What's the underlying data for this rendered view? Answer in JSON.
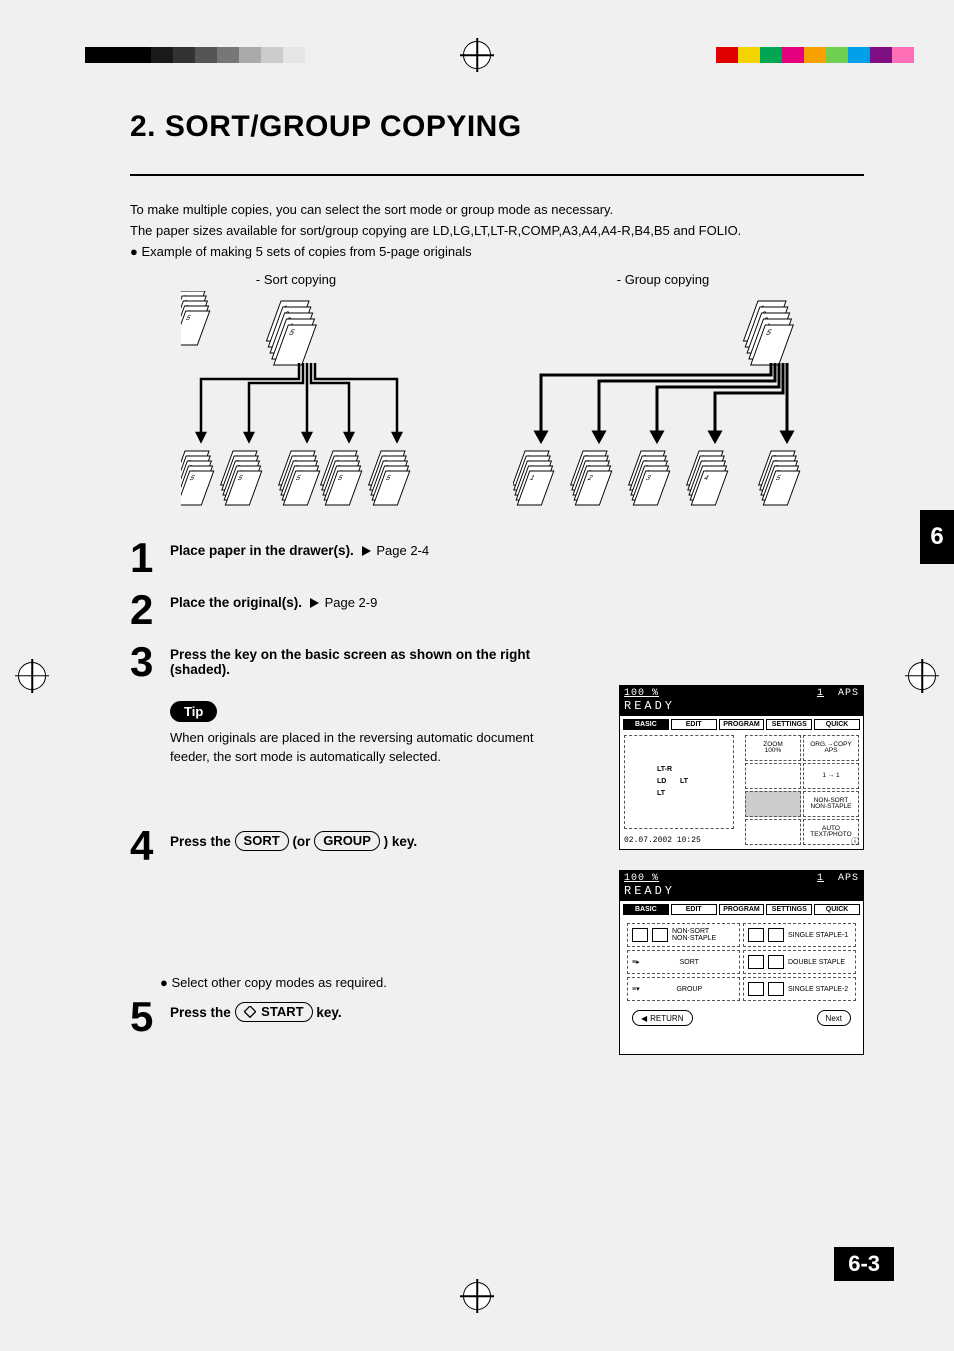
{
  "page": {
    "title": "2. SORT/GROUP COPYING",
    "chapter_tab": "6",
    "page_number": "6-3",
    "intro": {
      "line1": "To make multiple copies, you can select the sort mode or group mode as necessary.",
      "line2": "The paper sizes available for sort/group copying are LD,LG,LT,LT-R,COMP,A3,A4,A4-R,B4,B5 and FOLIO.",
      "bullet": "Example of making 5 sets of copies from 5-page originals"
    },
    "diagrams": {
      "sort_label": "- Sort copying",
      "group_label": "- Group copying"
    },
    "steps": [
      {
        "num": "1",
        "text_bold": "Place paper in the drawer(s).",
        "ref": "Page 2-4"
      },
      {
        "num": "2",
        "text_bold": "Place the original(s).",
        "ref": "Page 2-9"
      },
      {
        "num": "3",
        "text_bold": "Press the key on the basic screen as shown on the right (shaded).",
        "ref": ""
      },
      {
        "num": "4",
        "text_bold_prefix": "Press the ",
        "key1": "SORT",
        "mid": "(or ",
        "key2": "GROUP",
        "text_bold_suffix": ") key.",
        "ref": ""
      },
      {
        "num": "5",
        "text_bold_prefix": "Press the ",
        "startkey": "START",
        "text_bold_suffix": " key.",
        "ref": ""
      }
    ],
    "tip": {
      "label": "Tip",
      "text": "When originals are placed in the reversing automatic document feeder, the sort mode is automatically selected."
    },
    "note_between": "Select other copy modes as required.",
    "screenshot1": {
      "pct": "100 %",
      "qty": "1",
      "aps": "APS",
      "ready": "READY",
      "tabs": [
        "BASIC",
        "EDIT",
        "PROGRAM",
        "SETTINGS",
        "QUICK"
      ],
      "papers": [
        "LT-R",
        "LD",
        "LT",
        "LT"
      ],
      "right_cells": [
        "ZOOM\n100%",
        "ORG.→COPY\nAPS",
        "",
        "1 → 1",
        "",
        "NON-SORT\nNON-STAPLE",
        "",
        "AUTO\nTEXT/PHOTO"
      ],
      "datetime": "02.07.2002 10:25"
    },
    "screenshot2": {
      "pct": "100 %",
      "qty": "1",
      "aps": "APS",
      "ready": "READY",
      "tabs": [
        "BASIC",
        "EDIT",
        "PROGRAM",
        "SETTINGS",
        "QUICK"
      ],
      "left_opts": [
        "NON-SORT\nNON-STAPLE",
        "SORT",
        "GROUP"
      ],
      "right_opts": [
        "SINGLE STAPLE-1",
        "DOUBLE STAPLE",
        "SINGLE STAPLE-2"
      ],
      "return": "RETURN",
      "next": "Next"
    }
  }
}
